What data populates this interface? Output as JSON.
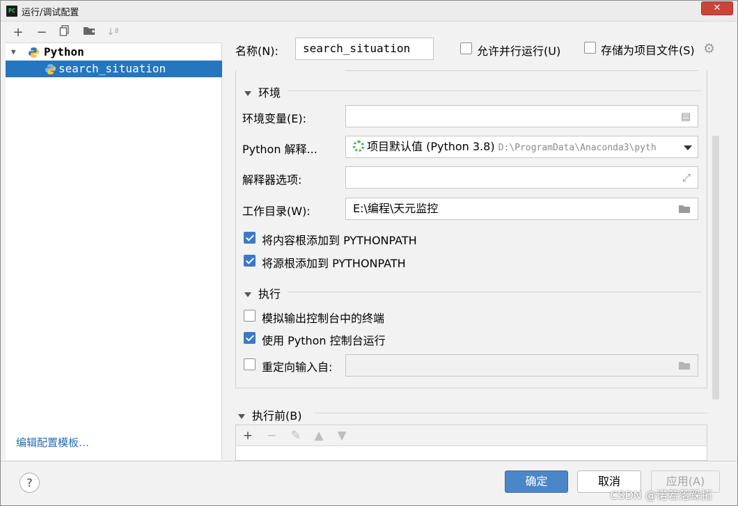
{
  "window": {
    "title": "运行/调试配置",
    "app_icon_text": "PC"
  },
  "left": {
    "tree": [
      {
        "label": "Python",
        "type": "group"
      },
      {
        "label": "search_situation",
        "type": "item",
        "selected": true
      }
    ],
    "edit_templates_link": "编辑配置模板…"
  },
  "header": {
    "name_label": "名称(N):",
    "name_value": "search_situation",
    "allow_parallel_label": "允许并行运行(U)",
    "store_as_file_label": "存储为项目文件(S)"
  },
  "environment": {
    "section_title": "环境",
    "env_vars_label": "环境变量(E):",
    "env_vars_value": "",
    "interpreter_label": "Python 解释...",
    "interpreter_value": "项目默认值 (Python 3.8)",
    "interpreter_path": "D:\\ProgramData\\Anaconda3\\pyth",
    "interpreter_options_label": "解释器选项:",
    "interpreter_options_value": "",
    "working_dir_label": "工作目录(W):",
    "working_dir_value": "E:\\编程\\天元监控",
    "add_content_roots_label": "将内容根添加到 PYTHONPATH",
    "add_content_roots_checked": true,
    "add_source_roots_label": "将源根添加到 PYTHONPATH",
    "add_source_roots_checked": true
  },
  "execution": {
    "section_title": "执行",
    "emulate_terminal_label": "模拟输出控制台中的终端",
    "emulate_terminal_checked": false,
    "use_python_console_label": "使用 Python 控制台运行",
    "use_python_console_checked": true,
    "redirect_input_label": "重定向输入自:",
    "redirect_input_checked": false
  },
  "before_launch": {
    "section_title": "执行前(B)"
  },
  "buttons": {
    "help": "?",
    "ok": "确定",
    "cancel": "取消",
    "apply": "应用(A)"
  },
  "watermark": "CSDN @诺若落跺拓"
}
